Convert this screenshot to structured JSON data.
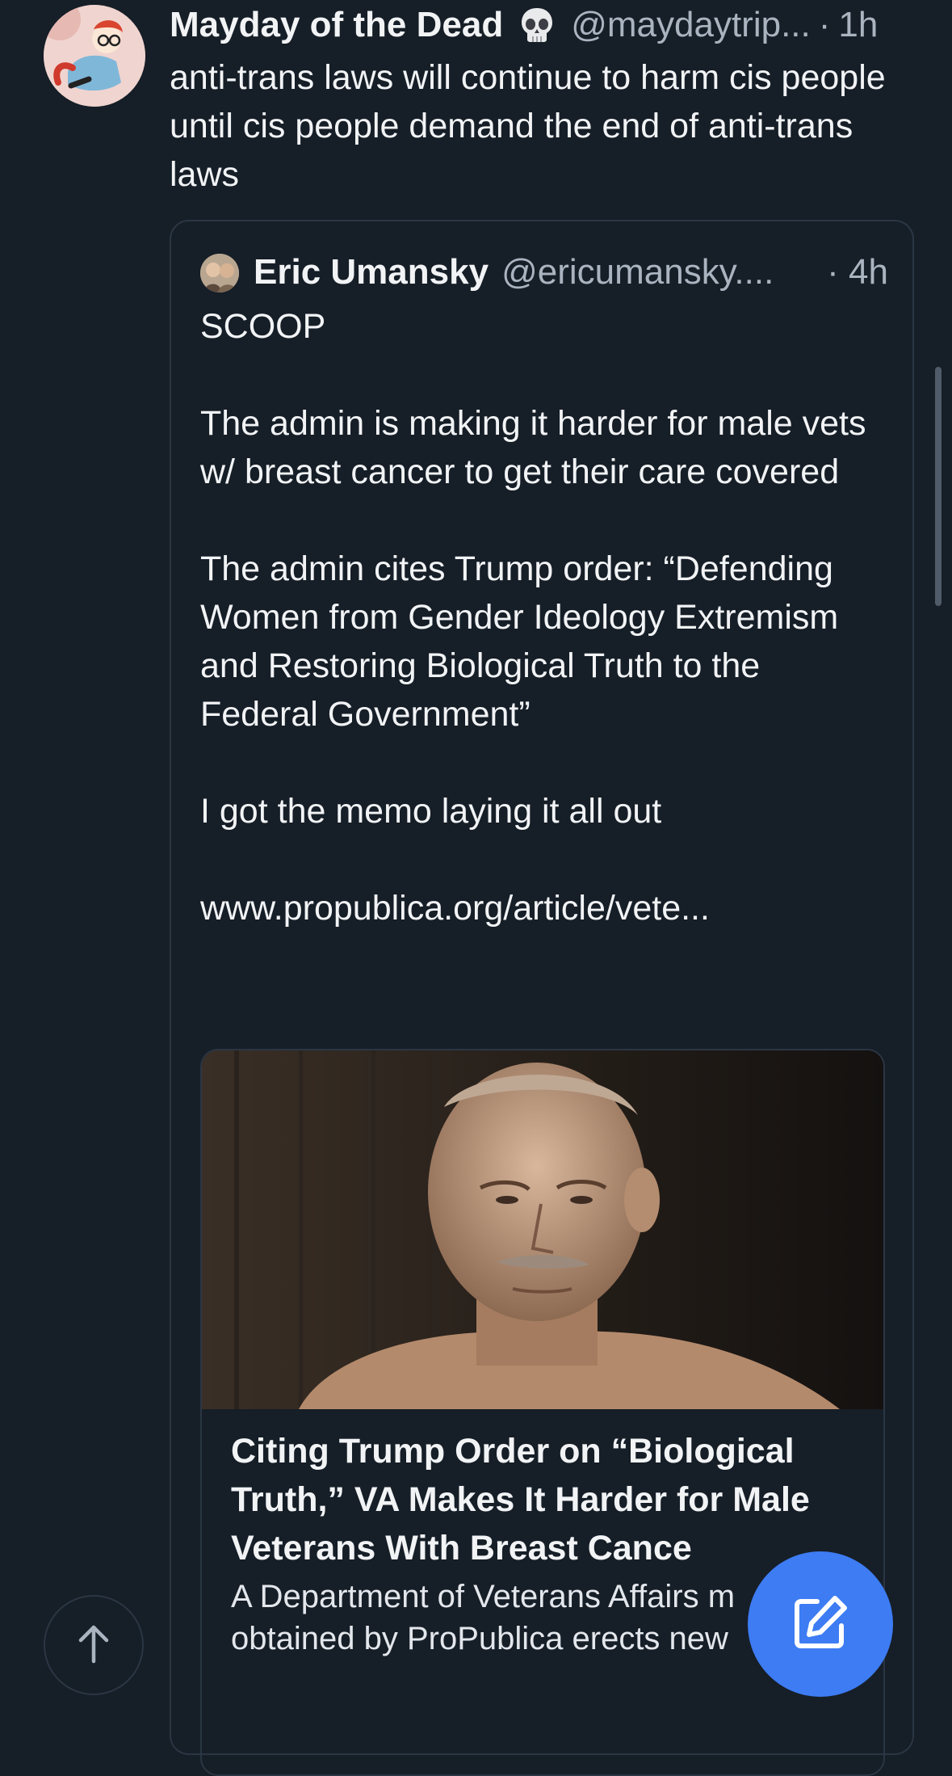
{
  "post": {
    "display_name": "Mayday of the Dead",
    "emoji_icon": "skull-emoji-icon",
    "handle": "@maydaytrip...",
    "separator": "·",
    "time": "1h",
    "text": "anti-trans laws will continue to harm cis people until cis people demand the end of anti-trans laws"
  },
  "quote": {
    "display_name": "Eric Umansky",
    "handle": "@ericumansky....",
    "time": "· 4h",
    "text": "SCOOP\n\nThe admin is making it harder for male vets w/ breast cancer to get their care covered\n\nThe admin cites Trump order: “Defending Women from Gender Ideology Extremism and Restoring Biological Truth to the Federal Government”\n\nI got the memo laying it all out\n\nwww.propublica.org/article/vete...",
    "link_card": {
      "title": "Citing Trump Order on “Biological Truth,” VA Makes It Harder for Male Veterans With Breast Cance",
      "description": "A Department of Veterans Affairs m obtained by ProPublica erects new"
    }
  },
  "controls": {
    "scroll_top_icon": "arrow-up-icon",
    "compose_icon": "compose-pencil-icon",
    "accent_color": "#3d7cf3"
  }
}
